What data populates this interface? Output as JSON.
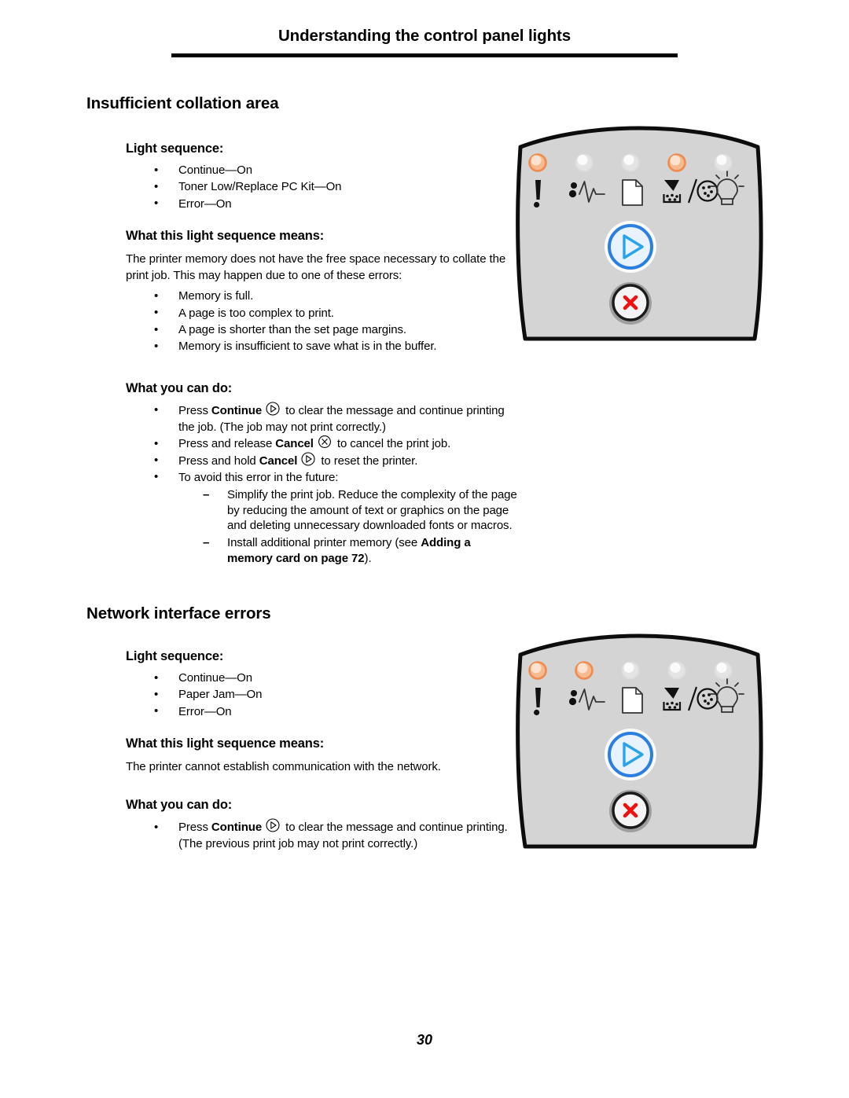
{
  "header": {
    "running_title": "Understanding the control panel lights"
  },
  "page_number": "30",
  "sections": [
    {
      "heading": "Insufficient collation area",
      "light_sequence_label": "Light sequence:",
      "light_sequence": [
        "Continue—On",
        "Toner Low/Replace PC Kit—On",
        "Error—On"
      ],
      "means_label": "What this light sequence means:",
      "means_text": "The printer memory does not have the free space necessary to collate the print job. This may happen due to one of these errors:",
      "means_bullets": [
        "Memory is full.",
        "A page is too complex to print.",
        "A page is shorter than the set page margins.",
        "Memory is insufficient to save what is in the buffer."
      ],
      "actions_label": "What you can do:",
      "actions": {
        "press_continue_pre": "Press ",
        "press_continue_bold": "Continue",
        "press_continue_post": "to clear the message and continue printing the job. (The job may not print correctly.)",
        "press_release_pre": "Press and release ",
        "press_release_bold": "Cancel",
        "press_release_post": "to cancel the print job.",
        "press_hold_pre": "Press and hold ",
        "press_hold_bold": "Cancel",
        "press_hold_post": "to reset the printer.",
        "avoid_label": "To avoid this error in the future:",
        "avoid_items": [
          {
            "text": "Simplify the print job. Reduce the complexity of the page by reducing the amount of text or graphics on the page and deleting unnecessary downloaded fonts or macros.",
            "bold_ref": "",
            "tail": ""
          },
          {
            "text": "Install additional printer memory (see ",
            "bold_ref": "Adding a memory card on page 72",
            "tail": ")."
          }
        ]
      },
      "panel": {
        "leds": [
          {
            "name": "error-led",
            "icon": "exclamation-icon",
            "lit": true
          },
          {
            "name": "paper-jam-led",
            "icon": "paper-jam-icon",
            "lit": false
          },
          {
            "name": "load-paper-led",
            "icon": "paper-icon",
            "lit": false
          },
          {
            "name": "toner-low-led",
            "icon": "toner-pc-kit-icon",
            "lit": true
          },
          {
            "name": "ready-led",
            "icon": "light-bulb-icon",
            "lit": false
          }
        ],
        "continue_button": "continue-button",
        "cancel_button": "cancel-button"
      }
    },
    {
      "heading": "Network interface errors",
      "light_sequence_label": "Light sequence:",
      "light_sequence": [
        "Continue—On",
        "Paper Jam—On",
        "Error—On"
      ],
      "means_label": "What this light sequence means:",
      "means_text": "The printer cannot establish communication with the network.",
      "means_bullets": [],
      "actions_label": "What you can do:",
      "actions": {
        "press_continue_pre": "Press ",
        "press_continue_bold": "Continue",
        "press_continue_post": "to clear the message and continue printing. (The previous print job may not print correctly.)"
      },
      "panel": {
        "leds": [
          {
            "name": "error-led",
            "icon": "exclamation-icon",
            "lit": true
          },
          {
            "name": "paper-jam-led",
            "icon": "paper-jam-icon",
            "lit": true
          },
          {
            "name": "load-paper-led",
            "icon": "paper-icon",
            "lit": false
          },
          {
            "name": "toner-low-led",
            "icon": "toner-pc-kit-icon",
            "lit": false
          },
          {
            "name": "ready-led",
            "icon": "light-bulb-icon",
            "lit": false
          }
        ],
        "continue_button": "continue-button",
        "cancel_button": "cancel-button"
      }
    }
  ],
  "colors": {
    "led_on_ring": "#f0935a",
    "led_on_fill": "#fbd9bf",
    "led_off_ring": "#d8d8d8",
    "led_off_fill": "#f2f2f2",
    "panel_face": "#d4d4d4",
    "continue_blue": "#2b7fe0",
    "continue_fill": "#ddeeff",
    "cancel_red": "#ee1111"
  }
}
